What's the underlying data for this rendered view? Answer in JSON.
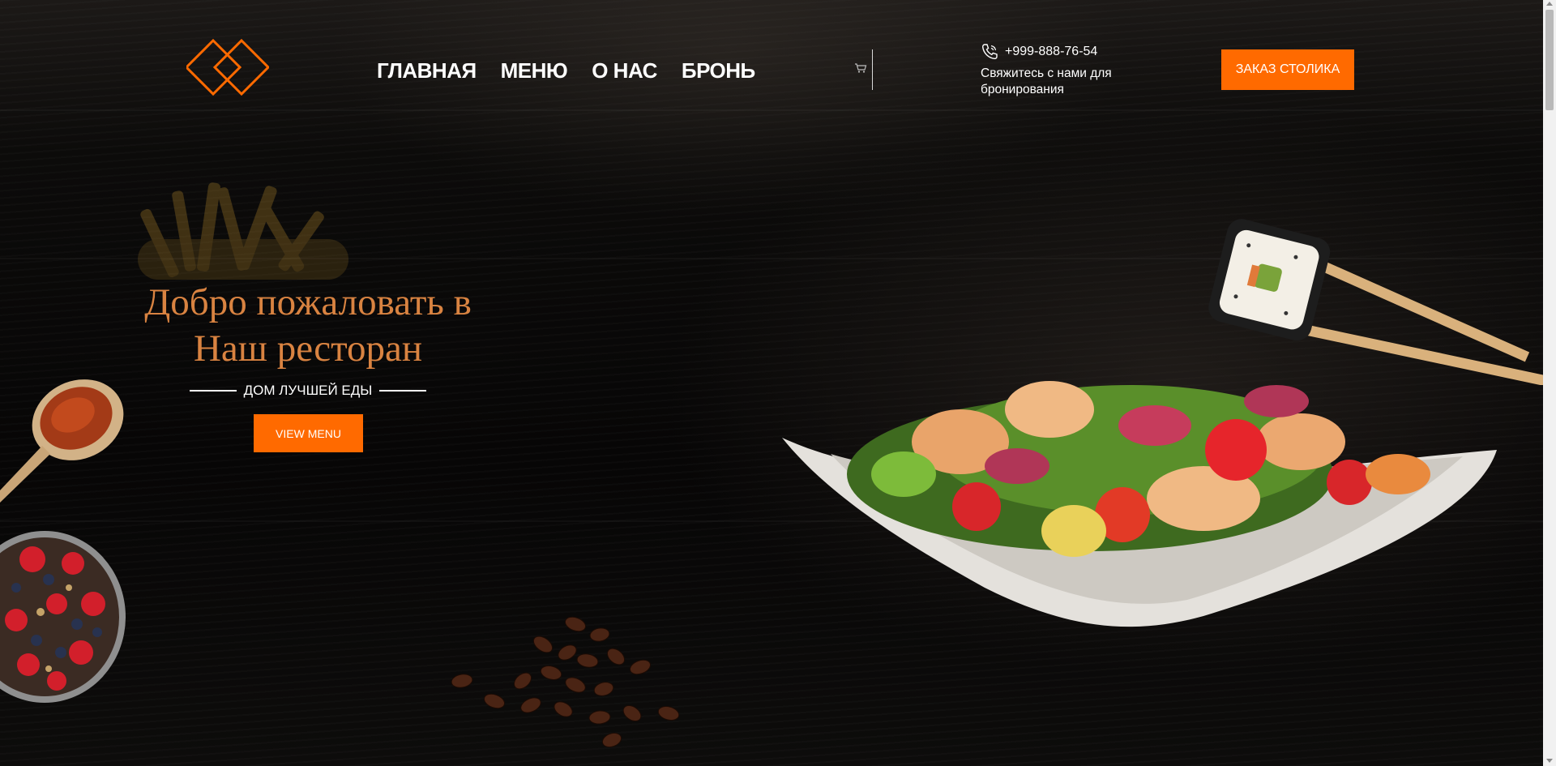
{
  "header": {
    "nav": [
      {
        "label": "ГЛАВНАЯ"
      },
      {
        "label": "МЕНЮ"
      },
      {
        "label": "О НАС"
      },
      {
        "label": "БРОНЬ"
      }
    ],
    "phone": "+999-888-76-54",
    "contact_text": "Свяжитесь с нами для бронирования",
    "order_button": "ЗАКАЗ СТОЛИКА"
  },
  "hero": {
    "title_line1": "Добро пожаловать в",
    "title_line2": "Наш ресторан",
    "subtitle": "ДОМ ЛУЧШЕЙ ЕДЫ",
    "cta": "VIEW MENU"
  },
  "icons": {
    "logo": "double-diamond-logo",
    "cart": "cart-icon",
    "phone": "phone-icon"
  },
  "colors": {
    "accent": "#ff6a00",
    "title": "#d98341",
    "background": "#0b0a09"
  }
}
